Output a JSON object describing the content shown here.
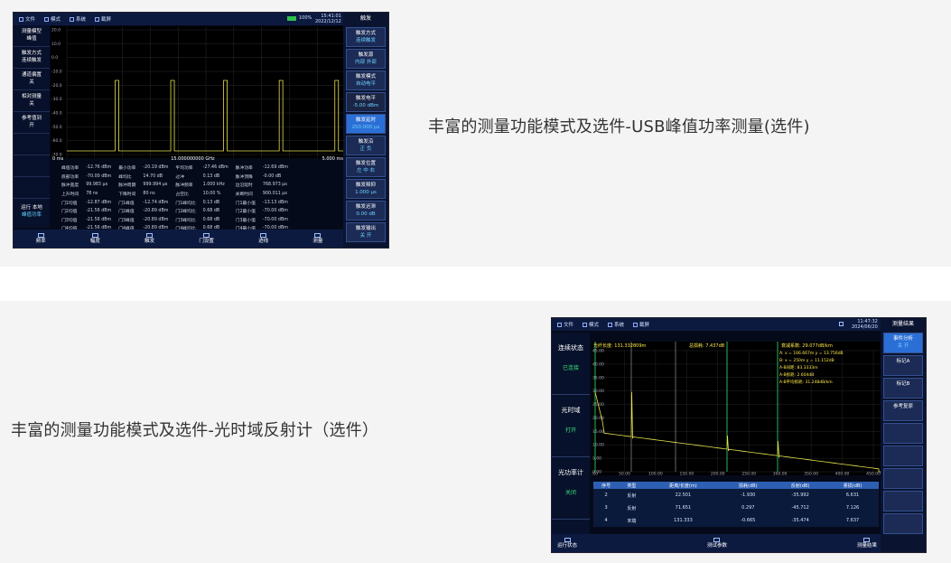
{
  "captions": {
    "first": "丰富的测量功能模式及选件-USB峰值功率测量(选件)",
    "second": "丰富的测量功能模式及选件-光时域反射计（选件）"
  },
  "screen1": {
    "menu": [
      "文件",
      "模式",
      "系统",
      "截屏"
    ],
    "battery": "100%",
    "time": "15:41:01",
    "date": "2022/12/12",
    "left": [
      {
        "label": "测量模型",
        "value": "峰值"
      },
      {
        "label": "触发方式",
        "value": "连续触发"
      },
      {
        "label": "通道偏置",
        "value": "关"
      },
      {
        "label": "相对测量",
        "value": "关"
      },
      {
        "label": "参考值到",
        "value": "开"
      }
    ],
    "left_status": {
      "label": "运行 本地",
      "value": "峰值功率"
    },
    "right_title": "触发",
    "right": [
      {
        "label": "触发方式",
        "value": "连续触发",
        "state": "normal"
      },
      {
        "label": "触发源",
        "value": "内部 外部",
        "state": "normal"
      },
      {
        "label": "触发模式",
        "value": "自动电平",
        "state": "normal"
      },
      {
        "label": "触发电平",
        "value": "-5.00 dBm",
        "state": "disabled"
      },
      {
        "label": "触发延时",
        "value": "250.000 μs",
        "state": "active"
      },
      {
        "label": "触发沿",
        "value": "正 负",
        "state": "normal"
      },
      {
        "label": "触发位置",
        "value": "左 中 右",
        "state": "normal"
      },
      {
        "label": "触发释抑",
        "value": "1.000 μs",
        "state": "normal"
      },
      {
        "label": "触发迟滞",
        "value": "0.00 dB",
        "state": "normal"
      },
      {
        "label": "触发输出",
        "value": "关 开",
        "state": "normal"
      }
    ],
    "y_ticks": [
      "20.0",
      "10.0",
      "0.0",
      "-10.0",
      "-20.0",
      "-30.0",
      "-40.0",
      "-50.0",
      "-60.0",
      "-70.0"
    ],
    "x_start": "0 ms",
    "x_center": "15.000000000 GHz",
    "x_end": "5.000 ms",
    "table": [
      [
        "峰值功率",
        "-12.76 dBm",
        "最小功率",
        "-20.19 dBm",
        "平均功率",
        "-27.46 dBm",
        "脉冲功率",
        "-12.69 dBm"
      ],
      [
        "底部功率",
        "-70.00 dBm",
        "峰均比",
        "14.70 dB",
        "过冲",
        "0.13 dB",
        "脉冲顶降",
        "-0.00 dB"
      ],
      [
        "脉冲宽度",
        "99.983 μs",
        "脉冲周期",
        "999.994 μs",
        "脉冲频率",
        "1.000 kHz",
        "边沿延时",
        "768.973 μs"
      ],
      [
        "上升时间",
        "78 ns",
        "下降时间",
        "80 ns",
        "占空比",
        "10.00 %",
        "关断时间",
        "900.011 μs"
      ],
      [
        "门1均值",
        "-12.87 dBm",
        "门1峰值",
        "-12.74 dBm",
        "门1峰均比",
        "0.13 dB",
        "门1最小值",
        "-13.13 dBm"
      ],
      [
        "门2均值",
        "-21.56 dBm",
        "门2峰值",
        "-20.89 dBm",
        "门2峰均比",
        "0.68 dB",
        "门2最小值",
        "-70.00 dBm"
      ],
      [
        "门3均值",
        "-21.56 dBm",
        "门3峰值",
        "-20.89 dBm",
        "门3峰均比",
        "0.68 dB",
        "门3最小值",
        "-70.00 dBm"
      ],
      [
        "门4均值",
        "-21.56 dBm",
        "门4峰值",
        "-20.89 dBm",
        "门4峰均比",
        "0.68 dB",
        "门4最小值",
        "-70.00 dBm"
      ]
    ],
    "bottom": [
      "频率",
      "幅度",
      "触发",
      "门设置",
      "迹线",
      "测量"
    ]
  },
  "screen2": {
    "menu": [
      "文件",
      "模式",
      "系统",
      "截屏"
    ],
    "time": "11:47:32",
    "date": "2024/06/20",
    "left": [
      {
        "label": "连续状态",
        "value": "已连接"
      },
      {
        "label": "光时域",
        "value": "打开"
      },
      {
        "label": "光功率计",
        "value": "关闭"
      }
    ],
    "fiber_length": "光纤长度: 131.332809m",
    "total_loss": "总损耗: 7.437dB",
    "avg_loss": "衰减系数: 29.077dB/km",
    "cursors": [
      "A:  x = 166.667m    y = 13.756dB",
      "B:  x = 250m    y = 11.152dB",
      "A-B间距:  83.3333m",
      "A-B损耗:  2.604dB",
      "A-B平均损耗:  31.248dB/km"
    ],
    "y_ticks": [
      "45.00",
      "40.00",
      "35.00",
      "30.00",
      "25.00",
      "20.00",
      "15.00",
      "10.00",
      "5.00",
      "0.00"
    ],
    "x_ticks": [
      "0.00",
      "50.00",
      "100.00",
      "150.00",
      "200.00",
      "250.00",
      "300.00",
      "350.00",
      "400.00",
      "450.00"
    ],
    "right_title": "测量结果",
    "right": [
      {
        "label": "事件分析",
        "value": "关 开",
        "state": "active"
      },
      {
        "label": "标记A",
        "value": "",
        "state": "normal"
      },
      {
        "label": "标记B",
        "value": "",
        "state": "normal"
      },
      {
        "label": "参考复原",
        "value": "",
        "state": "normal"
      },
      {
        "label": "",
        "value": "",
        "state": "normal"
      },
      {
        "label": "",
        "value": "",
        "state": "normal"
      },
      {
        "label": "",
        "value": "",
        "state": "normal"
      },
      {
        "label": "",
        "value": "",
        "state": "normal"
      },
      {
        "label": "",
        "value": "",
        "state": "normal"
      }
    ],
    "table_headers": [
      "序号",
      "类型",
      "距离/长度(m)",
      "损耗(dB)",
      "反射(dB)",
      "累损(dB)"
    ],
    "table_rows": [
      [
        "2",
        "反射",
        "22.501",
        "-1.930",
        "-35.992",
        "6.631"
      ],
      [
        "3",
        "反射",
        "71.651",
        "0.297",
        "-45.712",
        "7.126"
      ],
      [
        "4",
        "末端",
        "131.333",
        "-0.665",
        "-35.474",
        "7.637"
      ]
    ],
    "bottom": [
      "运行状态",
      "测试参数",
      "测量结果"
    ]
  }
}
